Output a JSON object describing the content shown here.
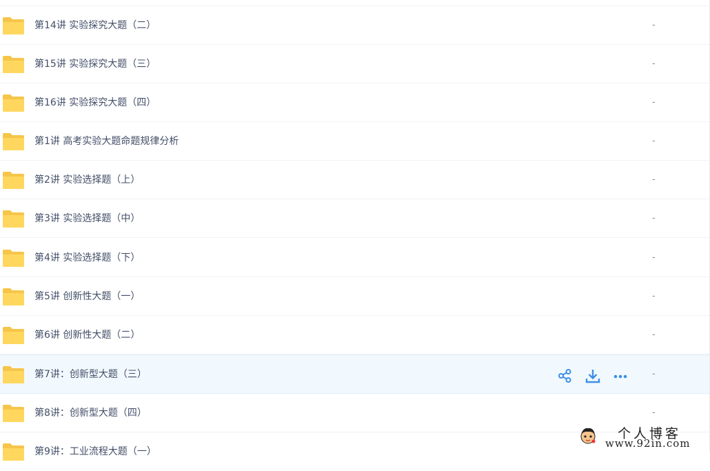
{
  "files": [
    {
      "name": "第14讲 实验探究大题（二）",
      "size": "-"
    },
    {
      "name": "第15讲 实验探究大题（三）",
      "size": "-"
    },
    {
      "name": "第16讲 实验探究大题（四）",
      "size": "-"
    },
    {
      "name": "第1讲 高考实验大题命题规律分析",
      "size": "-"
    },
    {
      "name": "第2讲 实验选择题（上）",
      "size": "-"
    },
    {
      "name": "第3讲 实验选择题（中）",
      "size": "-"
    },
    {
      "name": "第4讲 实验选择题（下）",
      "size": "-"
    },
    {
      "name": "第5讲 创新性大题（一）",
      "size": "-"
    },
    {
      "name": "第6讲 创新性大题（二）",
      "size": "-"
    },
    {
      "name": "第7讲：创新型大题（三）",
      "size": "-"
    },
    {
      "name": "第8讲：创新型大题（四）",
      "size": "-"
    },
    {
      "name": "第9讲：工业流程大题（一）",
      "size": ""
    }
  ],
  "hovered_row": 9,
  "row_actions": {
    "share_icon": "share-icon",
    "download_icon": "download-icon",
    "more_icon": "more-icon"
  },
  "watermark": {
    "title": "个人博客",
    "url": "www.92in.com"
  },
  "colors": {
    "accent": "#3d8fe5",
    "folder": "#ffd25f",
    "hover_bg": "#f2f9fe",
    "text": "#424e67"
  }
}
